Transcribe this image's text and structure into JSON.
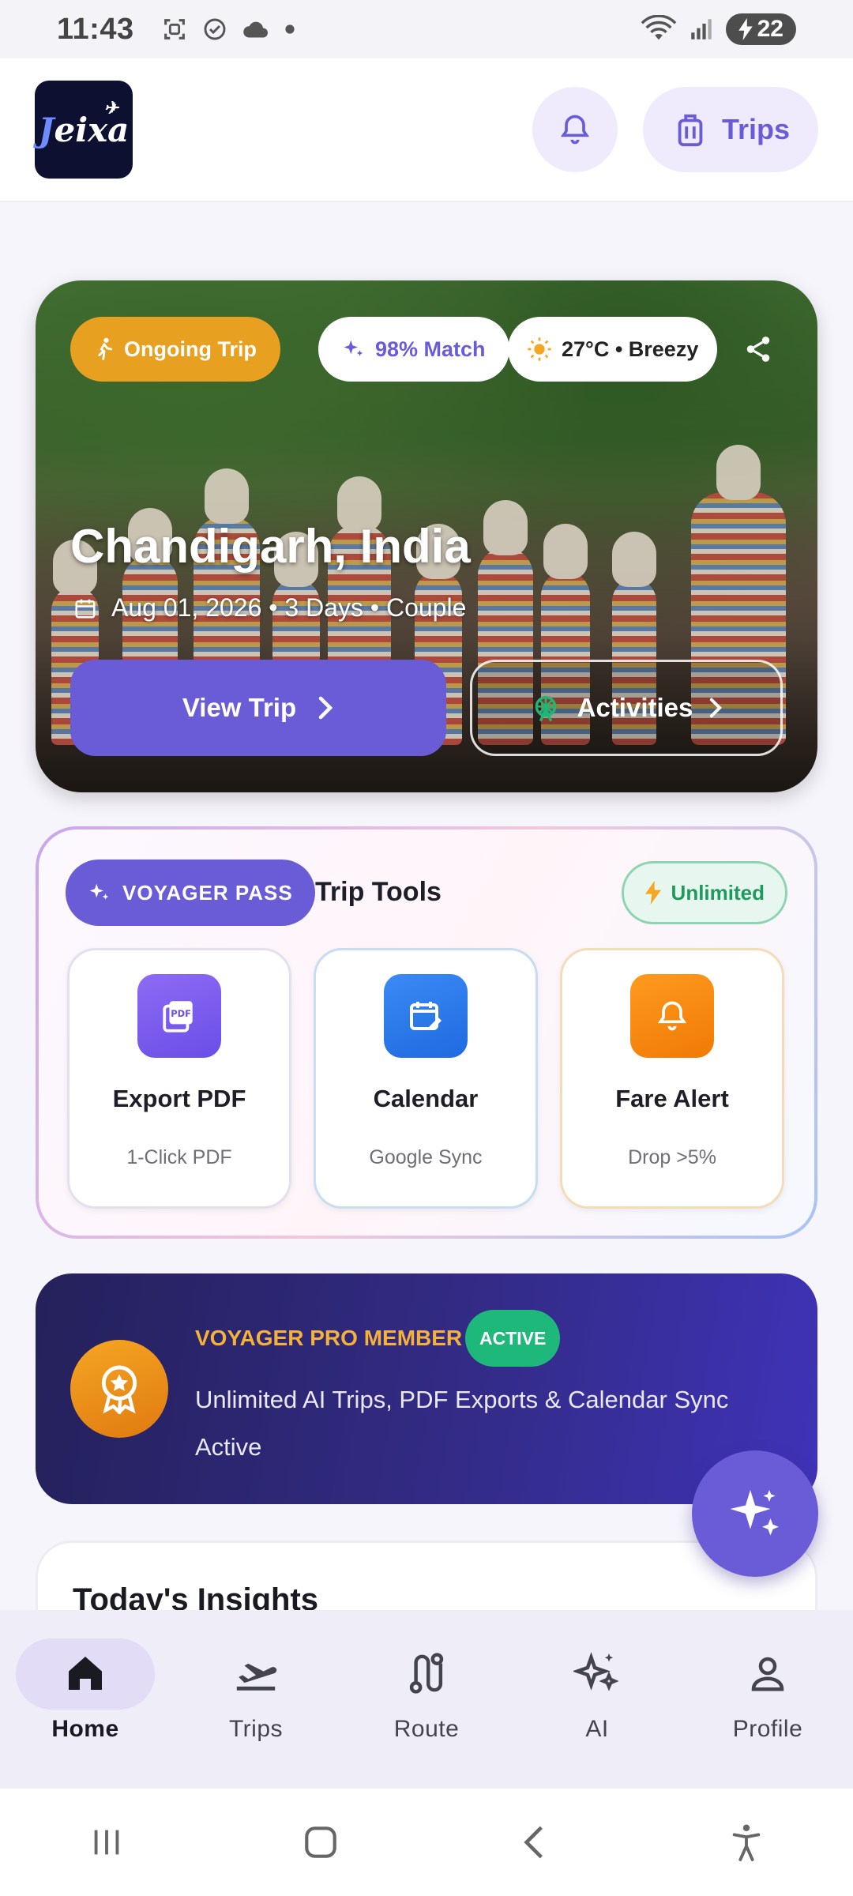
{
  "status_bar": {
    "time": "11:43",
    "battery": "22"
  },
  "header": {
    "logo_text": "eixa",
    "logo_letter": "J",
    "trips_label": "Trips"
  },
  "hero": {
    "badge_ongoing": "Ongoing Trip",
    "badge_match": "98% Match",
    "badge_weather": "27°C • Breezy",
    "destination": "Chandigarh, India",
    "details": "Aug 01, 2026 • 3 Days • Couple",
    "view_trip_label": "View Trip",
    "activities_label": "Activities"
  },
  "trip_tools": {
    "pass_label": "VOYAGER PASS",
    "title": "Trip Tools",
    "unlimited_label": "Unlimited",
    "cards": [
      {
        "title": "Export PDF",
        "subtitle": "1-Click PDF",
        "color": "#7b5cf0"
      },
      {
        "title": "Calendar",
        "subtitle": "Google Sync",
        "color": "#2a7af0"
      },
      {
        "title": "Fare Alert",
        "subtitle": "Drop >5%",
        "color": "#f58a0b"
      }
    ]
  },
  "pro_member": {
    "title": "VOYAGER PRO MEMBER",
    "status": "ACTIVE",
    "description": "Unlimited AI Trips, PDF Exports & Calendar Sync Active"
  },
  "insights": {
    "title": "Today's Insights"
  },
  "bottom_nav": [
    {
      "label": "Home",
      "icon": "home-icon",
      "active": true
    },
    {
      "label": "Trips",
      "icon": "flight-takeoff-icon"
    },
    {
      "label": "Route",
      "icon": "route-icon"
    },
    {
      "label": "AI",
      "icon": "sparkles-icon"
    },
    {
      "label": "Profile",
      "icon": "person-icon"
    }
  ],
  "colors": {
    "accent": "#6a5cd6",
    "ongoing": "#e8a020",
    "success": "#1db87a",
    "gold": "#f4b23a"
  }
}
